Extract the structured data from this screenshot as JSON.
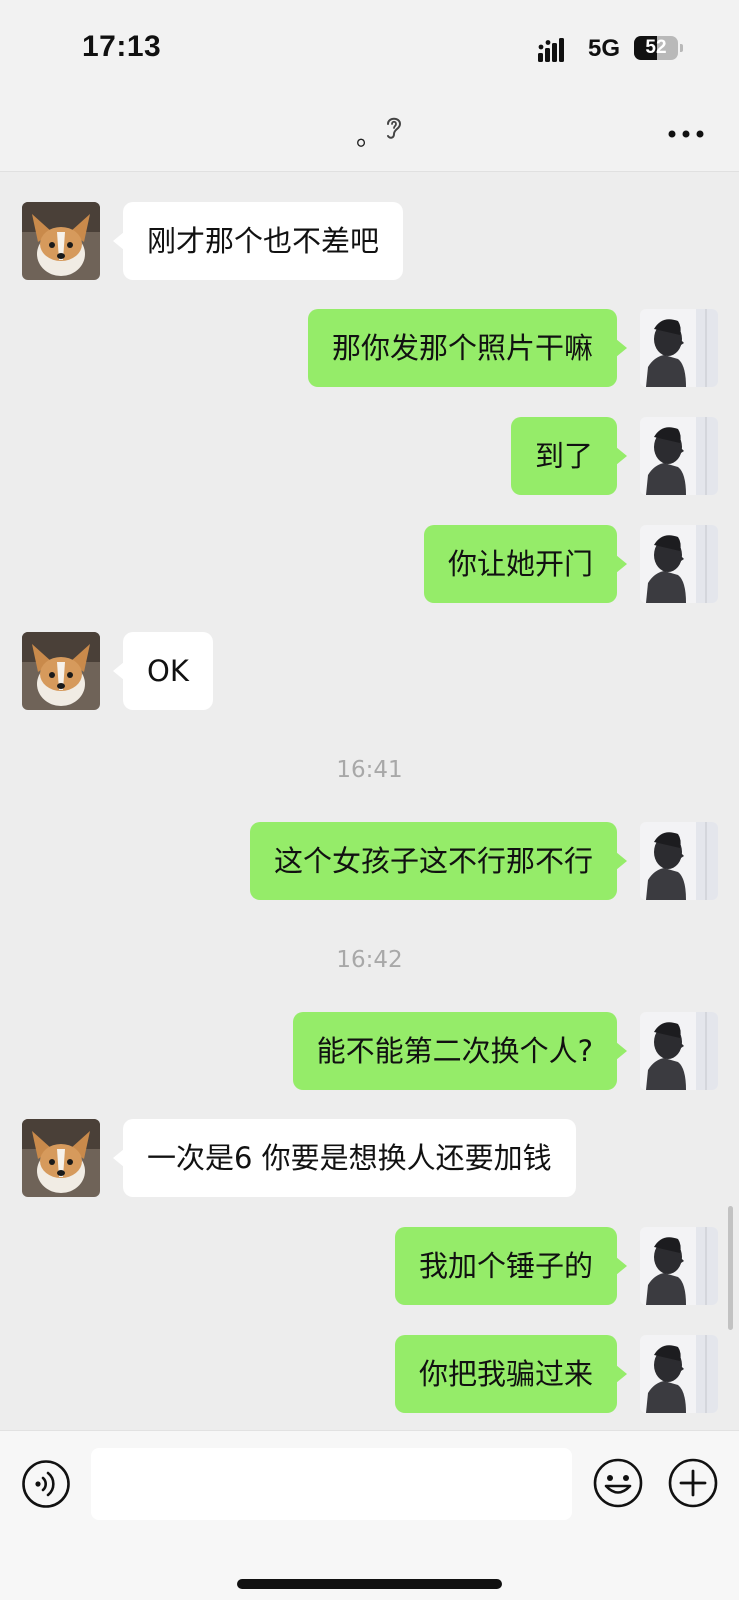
{
  "status_bar": {
    "time": "17:13",
    "network": "5G",
    "battery_level": "52",
    "battery_fraction": 0.52
  },
  "header": {
    "title": "。",
    "ear_icon": "ear-icon",
    "more_icon": "more-icon"
  },
  "messages": [
    {
      "type": "message",
      "from": "them",
      "text": "刚才那个也不差吧"
    },
    {
      "type": "message",
      "from": "me",
      "text": "那你发那个照片干嘛"
    },
    {
      "type": "message",
      "from": "me",
      "text": "到了"
    },
    {
      "type": "message",
      "from": "me",
      "text": "你让她开门"
    },
    {
      "type": "message",
      "from": "them",
      "text": "OK"
    },
    {
      "type": "timestamp",
      "text": "16:41"
    },
    {
      "type": "message",
      "from": "me",
      "text": "这个女孩子这不行那不行"
    },
    {
      "type": "timestamp",
      "text": "16:42"
    },
    {
      "type": "message",
      "from": "me",
      "text": "能不能第二次换个人?"
    },
    {
      "type": "message",
      "from": "them",
      "text": "一次是6 你要是想换人还要加钱"
    },
    {
      "type": "message",
      "from": "me",
      "text": "我加个锤子的"
    },
    {
      "type": "message",
      "from": "me",
      "text": "你把我骗过来"
    }
  ],
  "input_bar": {
    "value": "",
    "voice_icon": "voice-icon",
    "emoji_icon": "emoji-icon",
    "plus_icon": "plus-icon"
  },
  "colors": {
    "outgoing_bubble": "#95ec69",
    "incoming_bubble": "#ffffff",
    "chat_background": "#ededed"
  }
}
